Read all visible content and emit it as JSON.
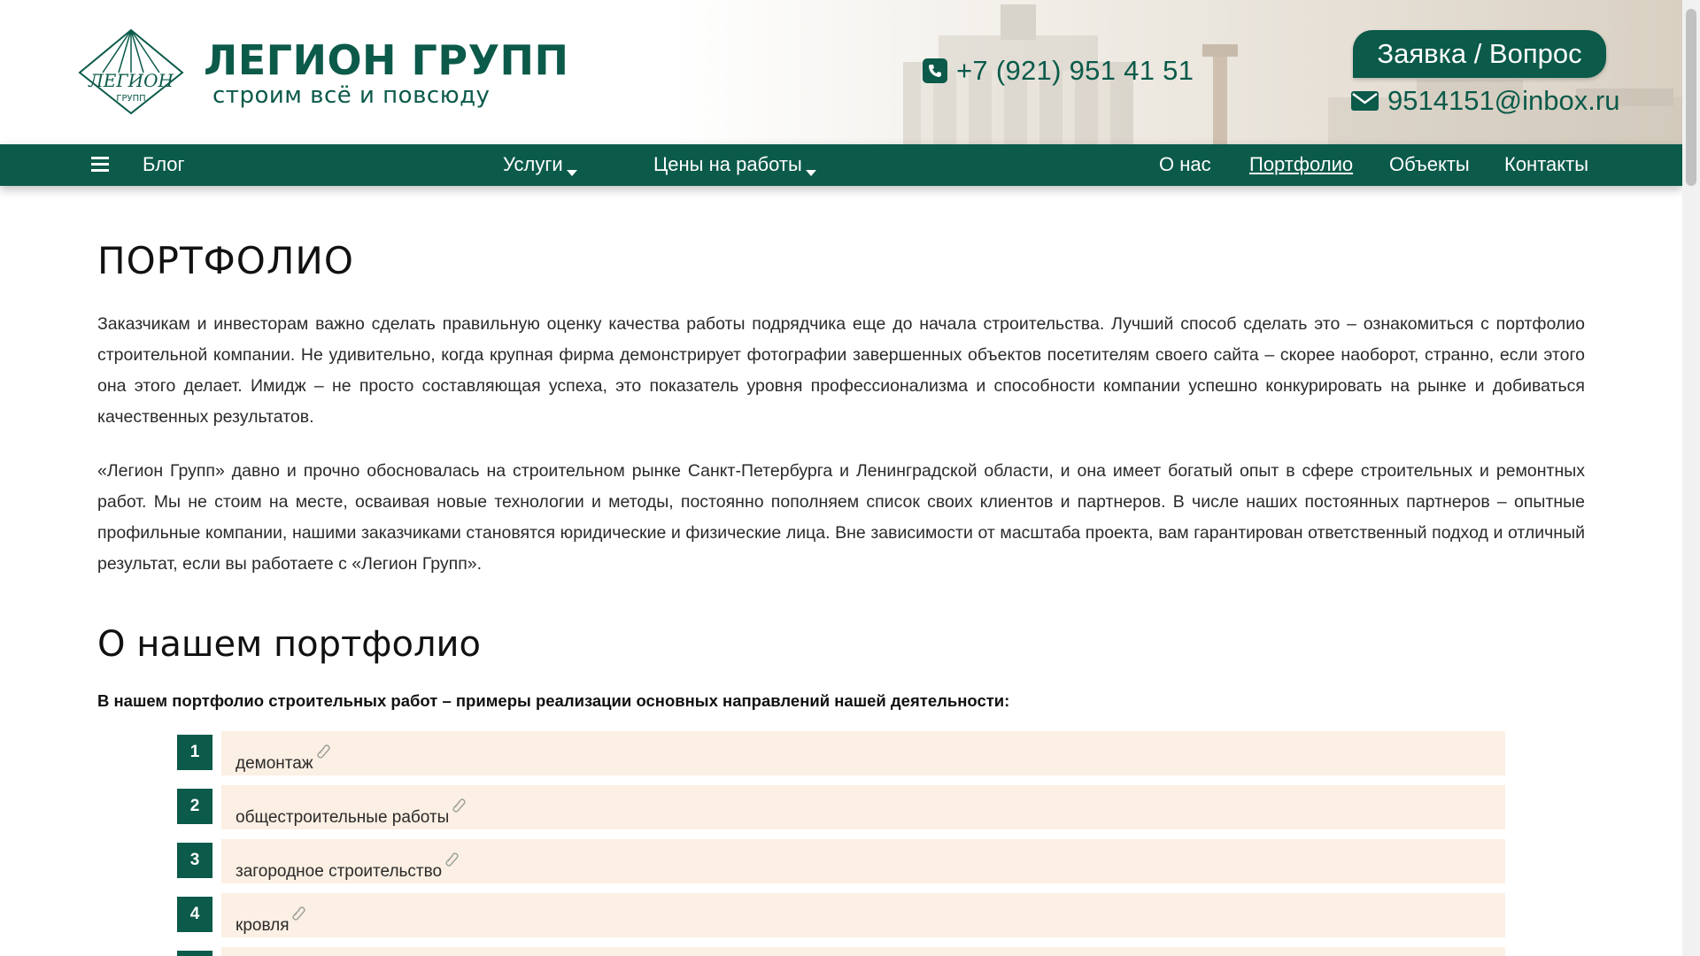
{
  "header": {
    "brand_title": "ЛЕГИОН ГРУПП",
    "brand_subtitle": "строим всё и повсюду",
    "logo_text_top": "ЛЕГИОН",
    "logo_text_bottom": "ГРУПП",
    "phone": "+7 (921) 951 41 51",
    "cta_label": "Заявка / Вопрос",
    "email": "9514151@inbox.ru"
  },
  "nav": {
    "blog": "Блог",
    "services": "Услуги",
    "prices": "Цены на работы",
    "about": "О нас",
    "portfolio": "Портфолио",
    "objects": "Объекты",
    "contacts": "Контакты"
  },
  "main": {
    "title": "ПОРТФОЛИО",
    "paragraph1": "Заказчикам и инвесторам важно сделать правильную оценку качества работы подрядчика еще до начала строительства. Лучший способ сделать это – ознакомиться с портфолио строительной компании. Не удивительно, когда крупная фирма демонстрирует фотографии завершенных объектов посетителям своего сайта – скорее наоборот, странно, если этого она этого делает. Имидж – не просто составляющая успеха, это показатель уровня профессионализма и способности компании успешно конкурировать на рынке и добиваться качественных результатов.",
    "paragraph2": "«Легион Групп» давно и прочно обосновалась на строительном рынке Санкт-Петербурга и Ленинградской области, и она имеет богатый опыт в сфере строительных и ремонтных работ. Мы не стоим на месте, осваивая новые технологии и методы, постоянно пополняем список своих клиентов и партнеров. В числе наших постоянных партнеров – опытные профильные компании, нашими заказчиками становятся юридические и физические лица. Вне зависимости от масштаба проекта, вам гарантирован ответственный подход и отличный результат, если вы работаете с «Легион Групп».",
    "subtitle": "О нашем портфолио",
    "lead": "В нашем портфолио строительных работ – примеры реализации основных направлений нашей деятельности:",
    "items": [
      {
        "num": "1",
        "label": "демонтаж"
      },
      {
        "num": "2",
        "label": "общестроительные работы"
      },
      {
        "num": "3",
        "label": "загородное строительство"
      },
      {
        "num": "4",
        "label": "кровля"
      }
    ]
  },
  "colors": {
    "brand": "#0b5a4a",
    "item_bg": "#fcefe3"
  }
}
